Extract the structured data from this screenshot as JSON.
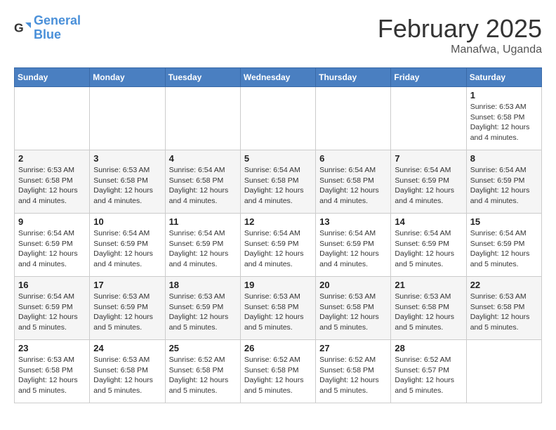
{
  "app": {
    "name": "GeneralBlue",
    "name_part1": "General",
    "name_part2": "Blue"
  },
  "header": {
    "month": "February 2025",
    "location": "Manafwa, Uganda"
  },
  "days_of_week": [
    "Sunday",
    "Monday",
    "Tuesday",
    "Wednesday",
    "Thursday",
    "Friday",
    "Saturday"
  ],
  "weeks": [
    [
      {
        "day": "",
        "info": ""
      },
      {
        "day": "",
        "info": ""
      },
      {
        "day": "",
        "info": ""
      },
      {
        "day": "",
        "info": ""
      },
      {
        "day": "",
        "info": ""
      },
      {
        "day": "",
        "info": ""
      },
      {
        "day": "1",
        "info": "Sunrise: 6:53 AM\nSunset: 6:58 PM\nDaylight: 12 hours and 4 minutes."
      }
    ],
    [
      {
        "day": "2",
        "info": "Sunrise: 6:53 AM\nSunset: 6:58 PM\nDaylight: 12 hours and 4 minutes."
      },
      {
        "day": "3",
        "info": "Sunrise: 6:53 AM\nSunset: 6:58 PM\nDaylight: 12 hours and 4 minutes."
      },
      {
        "day": "4",
        "info": "Sunrise: 6:54 AM\nSunset: 6:58 PM\nDaylight: 12 hours and 4 minutes."
      },
      {
        "day": "5",
        "info": "Sunrise: 6:54 AM\nSunset: 6:58 PM\nDaylight: 12 hours and 4 minutes."
      },
      {
        "day": "6",
        "info": "Sunrise: 6:54 AM\nSunset: 6:58 PM\nDaylight: 12 hours and 4 minutes."
      },
      {
        "day": "7",
        "info": "Sunrise: 6:54 AM\nSunset: 6:59 PM\nDaylight: 12 hours and 4 minutes."
      },
      {
        "day": "8",
        "info": "Sunrise: 6:54 AM\nSunset: 6:59 PM\nDaylight: 12 hours and 4 minutes."
      }
    ],
    [
      {
        "day": "9",
        "info": "Sunrise: 6:54 AM\nSunset: 6:59 PM\nDaylight: 12 hours and 4 minutes."
      },
      {
        "day": "10",
        "info": "Sunrise: 6:54 AM\nSunset: 6:59 PM\nDaylight: 12 hours and 4 minutes."
      },
      {
        "day": "11",
        "info": "Sunrise: 6:54 AM\nSunset: 6:59 PM\nDaylight: 12 hours and 4 minutes."
      },
      {
        "day": "12",
        "info": "Sunrise: 6:54 AM\nSunset: 6:59 PM\nDaylight: 12 hours and 4 minutes."
      },
      {
        "day": "13",
        "info": "Sunrise: 6:54 AM\nSunset: 6:59 PM\nDaylight: 12 hours and 4 minutes."
      },
      {
        "day": "14",
        "info": "Sunrise: 6:54 AM\nSunset: 6:59 PM\nDaylight: 12 hours and 5 minutes."
      },
      {
        "day": "15",
        "info": "Sunrise: 6:54 AM\nSunset: 6:59 PM\nDaylight: 12 hours and 5 minutes."
      }
    ],
    [
      {
        "day": "16",
        "info": "Sunrise: 6:54 AM\nSunset: 6:59 PM\nDaylight: 12 hours and 5 minutes."
      },
      {
        "day": "17",
        "info": "Sunrise: 6:53 AM\nSunset: 6:59 PM\nDaylight: 12 hours and 5 minutes."
      },
      {
        "day": "18",
        "info": "Sunrise: 6:53 AM\nSunset: 6:59 PM\nDaylight: 12 hours and 5 minutes."
      },
      {
        "day": "19",
        "info": "Sunrise: 6:53 AM\nSunset: 6:58 PM\nDaylight: 12 hours and 5 minutes."
      },
      {
        "day": "20",
        "info": "Sunrise: 6:53 AM\nSunset: 6:58 PM\nDaylight: 12 hours and 5 minutes."
      },
      {
        "day": "21",
        "info": "Sunrise: 6:53 AM\nSunset: 6:58 PM\nDaylight: 12 hours and 5 minutes."
      },
      {
        "day": "22",
        "info": "Sunrise: 6:53 AM\nSunset: 6:58 PM\nDaylight: 12 hours and 5 minutes."
      }
    ],
    [
      {
        "day": "23",
        "info": "Sunrise: 6:53 AM\nSunset: 6:58 PM\nDaylight: 12 hours and 5 minutes."
      },
      {
        "day": "24",
        "info": "Sunrise: 6:53 AM\nSunset: 6:58 PM\nDaylight: 12 hours and 5 minutes."
      },
      {
        "day": "25",
        "info": "Sunrise: 6:52 AM\nSunset: 6:58 PM\nDaylight: 12 hours and 5 minutes."
      },
      {
        "day": "26",
        "info": "Sunrise: 6:52 AM\nSunset: 6:58 PM\nDaylight: 12 hours and 5 minutes."
      },
      {
        "day": "27",
        "info": "Sunrise: 6:52 AM\nSunset: 6:58 PM\nDaylight: 12 hours and 5 minutes."
      },
      {
        "day": "28",
        "info": "Sunrise: 6:52 AM\nSunset: 6:57 PM\nDaylight: 12 hours and 5 minutes."
      },
      {
        "day": "",
        "info": ""
      }
    ]
  ]
}
